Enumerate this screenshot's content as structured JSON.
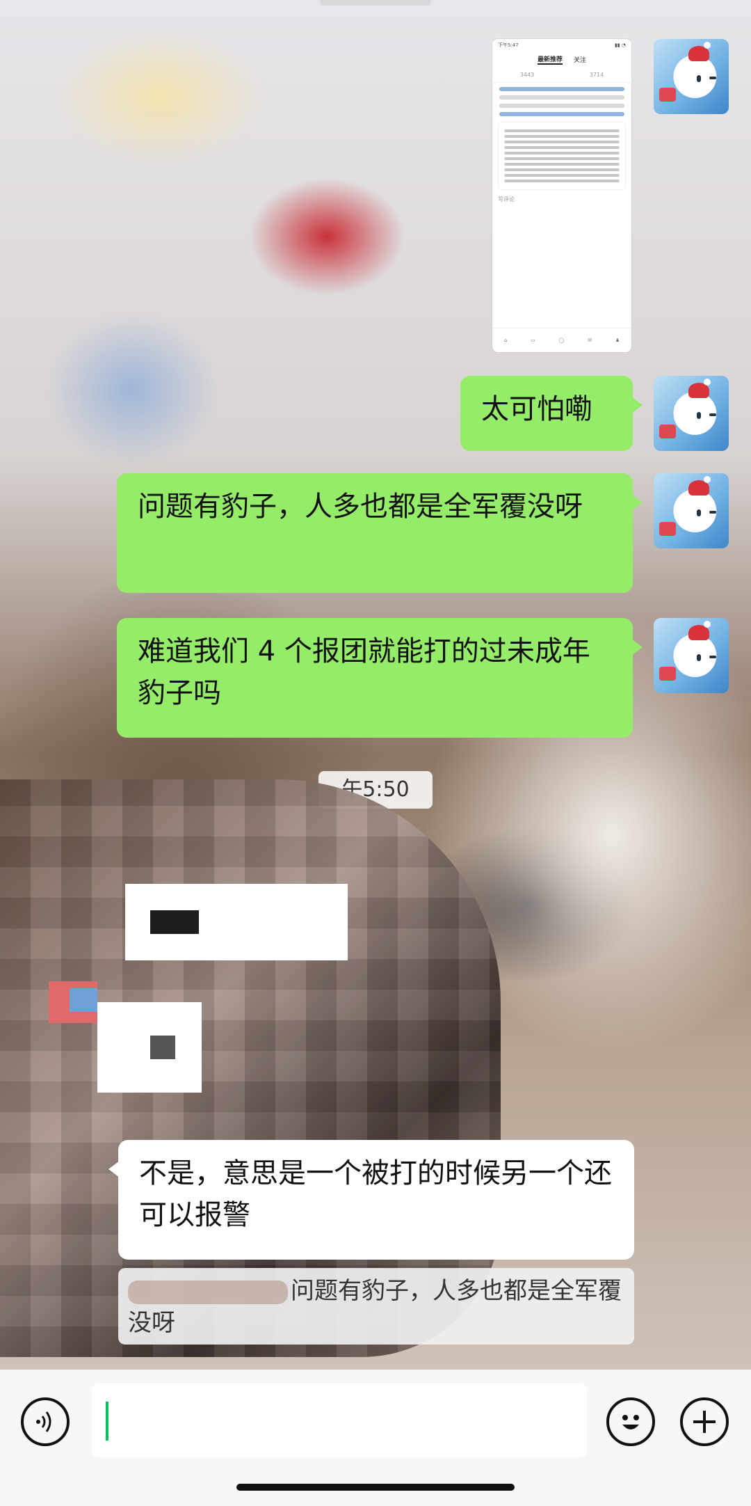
{
  "screenshot": {
    "status_time": "下午5:47",
    "tabs": [
      "最新推荐",
      "关注"
    ],
    "counts": [
      "3443",
      "3714"
    ],
    "reply_placeholder": "写评论"
  },
  "messages": [
    {
      "text": "太可怕嘞"
    },
    {
      "text": "问题有豹子，人多也都是全军覆没呀"
    },
    {
      "text": "难道我们 4 个报团就能打的过未成年豹子吗"
    },
    {
      "text": "不是，意思是一个被打的时候另一个还可以报警"
    }
  ],
  "timestamp": "午5:50",
  "quote": {
    "text": "问题有豹子，人多也都是全军覆没呀"
  },
  "input": {
    "value": ""
  },
  "icons": {
    "voice": "voice-icon",
    "emoji": "emoji-icon",
    "plus": "plus-icon"
  },
  "colors": {
    "self_bubble": "#95ec69",
    "other_bubble": "#ffffff",
    "caret": "#07c160"
  }
}
